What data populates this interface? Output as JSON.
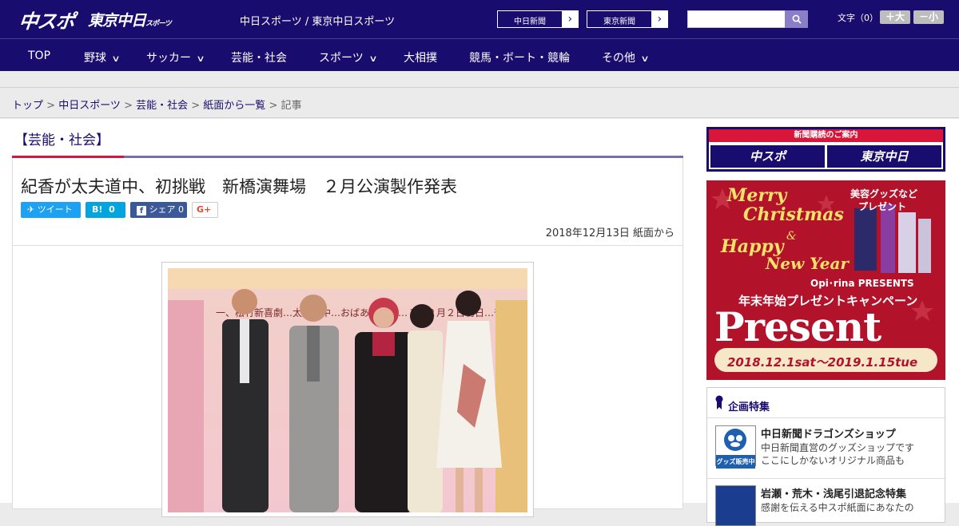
{
  "header": {
    "logo_primary": "中スポ",
    "logo_secondary": "東京中日",
    "logo_secondary_small": "スポーツ",
    "site_name": "中日スポーツ / 東京中日スポーツ",
    "paper_links": [
      {
        "label": "中日新聞"
      },
      {
        "label": "東京新聞"
      }
    ],
    "search": {
      "value": "",
      "icon": "search-icon"
    },
    "font_size_label": "文字（0）",
    "font_larger": "＋大",
    "font_smaller": "－小"
  },
  "nav": [
    {
      "label": "TOP",
      "dropdown": false
    },
    {
      "label": "野球",
      "dropdown": true
    },
    {
      "label": "サッカー",
      "dropdown": true
    },
    {
      "label": "芸能・社会",
      "dropdown": false
    },
    {
      "label": "スポーツ",
      "dropdown": true
    },
    {
      "label": "大相撲",
      "dropdown": false
    },
    {
      "label": "競馬・ボート・競輪",
      "dropdown": false
    },
    {
      "label": "その他",
      "dropdown": true
    }
  ],
  "breadcrumb": {
    "items": [
      "トップ",
      "中日スポーツ",
      "芸能・社会",
      "紙面から一覧"
    ],
    "separator": " > ",
    "current": "記事"
  },
  "category": "【芸能・社会】",
  "article": {
    "title": "紀香が太夫道中、初挑戦　新橋演舞場　２月公演製作発表",
    "share": {
      "tweet": "ツイート",
      "hatena_label": "B!",
      "hatena_count": "0",
      "facebook_label": "シェア",
      "facebook_count": "0",
      "gplus": "G+"
    },
    "date": "2018年12月13日 紙面から",
    "photo_banner_text": "一、松竹新喜劇…太夫道中…おばあちゃん…１年２月２日初日…千穐楽"
  },
  "sidebar": {
    "subscription": {
      "heading": "新聞購読のご案内",
      "buttons": [
        "中スポ",
        "東京中日"
      ]
    },
    "ad": {
      "merry": "Merry",
      "christmas": "Christmas",
      "amp": "&",
      "happy": "Happy",
      "new_year": "New Year",
      "goods_line1": "美容グッズなど",
      "goods_line2": "プレゼント",
      "brand": "Opi･rina PRESENTS",
      "campaign": "年末年始プレゼントキャンペーン",
      "present": "Present",
      "period": "2018.12.1sat～2019.1.15tue"
    },
    "features": {
      "heading": "企画特集",
      "items": [
        {
          "title": "中日新聞ドラゴンズショップ",
          "desc1": "中日新聞直営のグッズショップです",
          "desc2": "ここにしかないオリジナル商品も",
          "thumb_text": "グッズ販売中"
        },
        {
          "title": "岩瀬・荒木・浅尾引退記念特集",
          "desc1": "感謝を伝える中スポ紙面にあなたの"
        }
      ]
    }
  },
  "colors": {
    "brand_navy": "#180d6e",
    "accent_red": "#d7163a",
    "twitter": "#1da1f2",
    "hatena": "#00a4de",
    "facebook": "#3b5998"
  }
}
